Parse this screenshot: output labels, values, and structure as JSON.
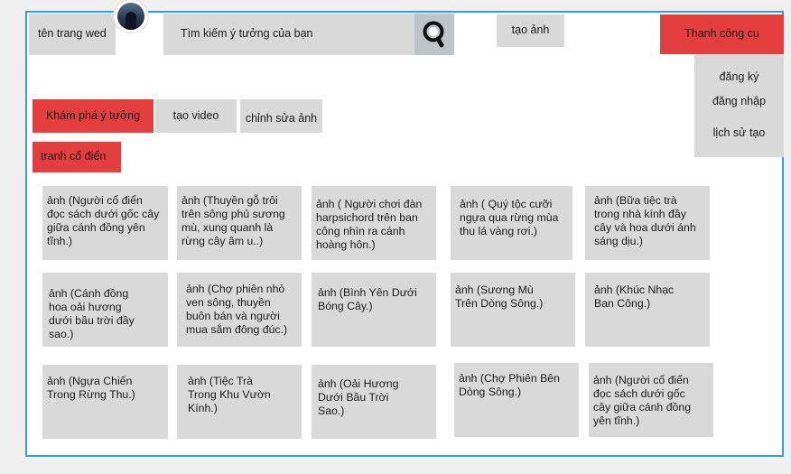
{
  "header": {
    "site_name": "tên trang wed",
    "search_placeholder": "Tìm kiếm ý tưởng của bạn",
    "create_image": "tạo ảnh",
    "toolbar": "Thanh công cụ"
  },
  "menu": {
    "items": [
      {
        "label": "đăng ký"
      },
      {
        "label": "đăng nhập"
      },
      {
        "label": "lịch sử tạo"
      }
    ]
  },
  "tabs": [
    {
      "label": "Khám phá ý tưởng",
      "active": true
    },
    {
      "label": "tạo video",
      "active": false
    },
    {
      "label": "chỉnh sửa ảnh",
      "active": false
    }
  ],
  "category": "tranh cổ điển",
  "cards": [
    "ảnh (Người cổ điển đọc sách dưới gốc cây giữa cánh đồng yên tĩnh.)",
    "ảnh (Thuyền gỗ trôi trên sông phủ sương mù, xung quanh là rừng cây âm u..)",
    "ảnh ( Người chơi đàn harpsichord trên ban công nhìn ra cánh hoàng hôn.)",
    "ảnh ( Quý tộc cưỡi ngựa qua rừng mùa thu lá vàng rơi.)",
    "ảnh (Bữa tiệc trà trong nhà kính đầy cây và hoa dưới ánh sáng dịu.)",
    "ảnh (Cánh đồng hoa oải hương dưới bầu trời đầy sao.)",
    "ảnh (Chợ phiên nhỏ ven sông, thuyền buôn bán và người mua sắm đông đúc.)",
    "ảnh (Bình Yên Dưới Bóng Cây.)",
    "ảnh (Sương Mù Trên Dòng Sông.)",
    "ảnh (Khúc Nhạc Ban Công.)",
    "ảnh (Ngựa Chiến Trong Rừng Thu.)",
    "ảnh (Tiệc Trà Trong Khu Vườn Kính.)",
    "ảnh (Oải Hương Dưới Bầu Trời Sao.)",
    "ảnh (Chợ Phiên Bên Dòng Sông.)",
    "ảnh (Người cổ điển đọc sách dưới gốc cây giữa cánh đồng yên tĩnh.)"
  ],
  "colors": {
    "accent": "#e53e3e",
    "frame": "#2e9cf0",
    "tile": "#d9d9d9"
  }
}
